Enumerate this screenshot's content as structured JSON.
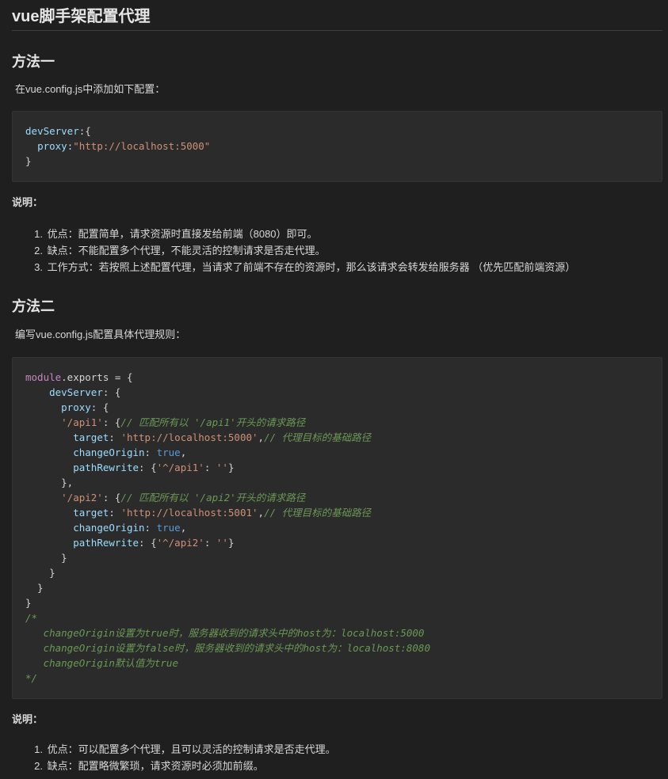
{
  "title": "vue脚手架配置代理",
  "method1": {
    "heading": "方法一",
    "intro": "在vue.config.js中添加如下配置：",
    "code": [
      [
        [
          "prop",
          "devServer"
        ],
        [
          "plain",
          ":{"
        ]
      ],
      [
        [
          "plain",
          "  "
        ],
        [
          "prop",
          "proxy"
        ],
        [
          "plain",
          ":"
        ],
        [
          "str",
          "\"http://localhost:5000\""
        ]
      ],
      [
        [
          "plain",
          "}"
        ]
      ]
    ],
    "note_label": "说明：",
    "notes": [
      {
        "num": "1.",
        "text": "优点：配置简单，请求资源时直接发给前端（8080）即可。"
      },
      {
        "num": "2.",
        "text": "缺点：不能配置多个代理，不能灵活的控制请求是否走代理。"
      },
      {
        "num": "3.",
        "text": "工作方式：若按照上述配置代理，当请求了前端不存在的资源时，那么该请求会转发给服务器 （优先匹配前端资源）"
      }
    ]
  },
  "method2": {
    "heading": "方法二",
    "intro": "编写vue.config.js配置具体代理规则：",
    "code": [
      [
        [
          "kw",
          "module"
        ],
        [
          "plain",
          ".exports = {"
        ]
      ],
      [
        [
          "plain",
          "    "
        ],
        [
          "prop",
          "devServer"
        ],
        [
          "plain",
          ": {"
        ]
      ],
      [
        [
          "plain",
          "      "
        ],
        [
          "prop",
          "proxy"
        ],
        [
          "plain",
          ": {"
        ]
      ],
      [
        [
          "plain",
          "      "
        ],
        [
          "str",
          "'/api1'"
        ],
        [
          "plain",
          ": {"
        ],
        [
          "cm",
          "// 匹配所有以 '/api1'开头的请求路径"
        ]
      ],
      [
        [
          "plain",
          "        "
        ],
        [
          "prop",
          "target"
        ],
        [
          "plain",
          ": "
        ],
        [
          "str",
          "'http://localhost:5000'"
        ],
        [
          "plain",
          ","
        ],
        [
          "cm",
          "// 代理目标的基础路径"
        ]
      ],
      [
        [
          "plain",
          "        "
        ],
        [
          "prop",
          "changeOrigin"
        ],
        [
          "plain",
          ": "
        ],
        [
          "bool",
          "true"
        ],
        [
          "plain",
          ","
        ]
      ],
      [
        [
          "plain",
          "        "
        ],
        [
          "prop",
          "pathRewrite"
        ],
        [
          "plain",
          ": {"
        ],
        [
          "str",
          "'^/api1'"
        ],
        [
          "plain",
          ": "
        ],
        [
          "str",
          "''"
        ],
        [
          "plain",
          "}"
        ]
      ],
      [
        [
          "plain",
          "      },"
        ]
      ],
      [
        [
          "plain",
          "      "
        ],
        [
          "str",
          "'/api2'"
        ],
        [
          "plain",
          ": {"
        ],
        [
          "cm",
          "// 匹配所有以 '/api2'开头的请求路径"
        ]
      ],
      [
        [
          "plain",
          "        "
        ],
        [
          "prop",
          "target"
        ],
        [
          "plain",
          ": "
        ],
        [
          "str",
          "'http://localhost:5001'"
        ],
        [
          "plain",
          ","
        ],
        [
          "cm",
          "// 代理目标的基础路径"
        ]
      ],
      [
        [
          "plain",
          "        "
        ],
        [
          "prop",
          "changeOrigin"
        ],
        [
          "plain",
          ": "
        ],
        [
          "bool",
          "true"
        ],
        [
          "plain",
          ","
        ]
      ],
      [
        [
          "plain",
          "        "
        ],
        [
          "prop",
          "pathRewrite"
        ],
        [
          "plain",
          ": {"
        ],
        [
          "str",
          "'^/api2'"
        ],
        [
          "plain",
          ": "
        ],
        [
          "str",
          "''"
        ],
        [
          "plain",
          "}"
        ]
      ],
      [
        [
          "plain",
          "      }"
        ]
      ],
      [
        [
          "plain",
          "    }"
        ]
      ],
      [
        [
          "plain",
          "  }"
        ]
      ],
      [
        [
          "plain",
          "}"
        ]
      ],
      [
        [
          "cm",
          "/*"
        ]
      ],
      [
        [
          "cm",
          "   changeOrigin设置为true时，服务器收到的请求头中的host为：localhost:5000"
        ]
      ],
      [
        [
          "cm",
          "   changeOrigin设置为false时，服务器收到的请求头中的host为：localhost:8080"
        ]
      ],
      [
        [
          "cm",
          "   changeOrigin默认值为true"
        ]
      ],
      [
        [
          "cm",
          "*/"
        ]
      ]
    ],
    "note_label": "说明：",
    "notes": [
      {
        "num": "1.",
        "text": "优点：可以配置多个代理，且可以灵活的控制请求是否走代理。"
      },
      {
        "num": "2.",
        "text": "缺点：配置略微繁琐，请求资源时必须加前缀。"
      }
    ]
  }
}
